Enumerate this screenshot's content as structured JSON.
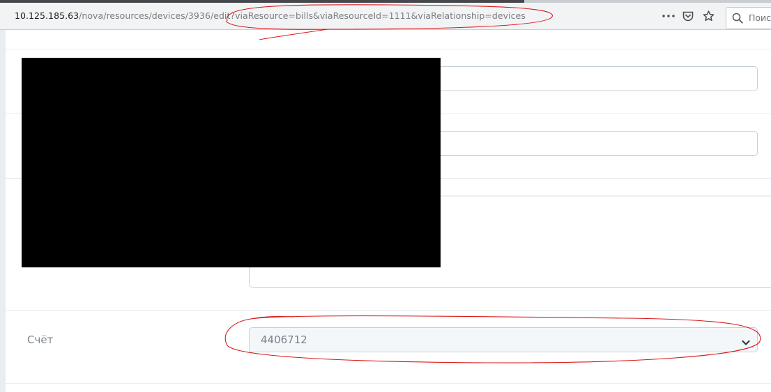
{
  "browser": {
    "url_host": "10.125.185.63",
    "url_path": "/nova/resources/devices/3936/edit?viaResource=bills&viaResourceId=1111&viaRelationship=devices",
    "search_placeholder": "Поиск",
    "page_actions": {
      "more_icon": "more-dots-icon",
      "pocket_icon": "pocket-icon",
      "bookmark_icon": "star-icon"
    }
  },
  "form": {
    "bill_field": {
      "label": "Счёт",
      "selected_value": "4406712"
    }
  },
  "colors": {
    "annotation": "#d81b1b",
    "redaction": "#000000"
  }
}
